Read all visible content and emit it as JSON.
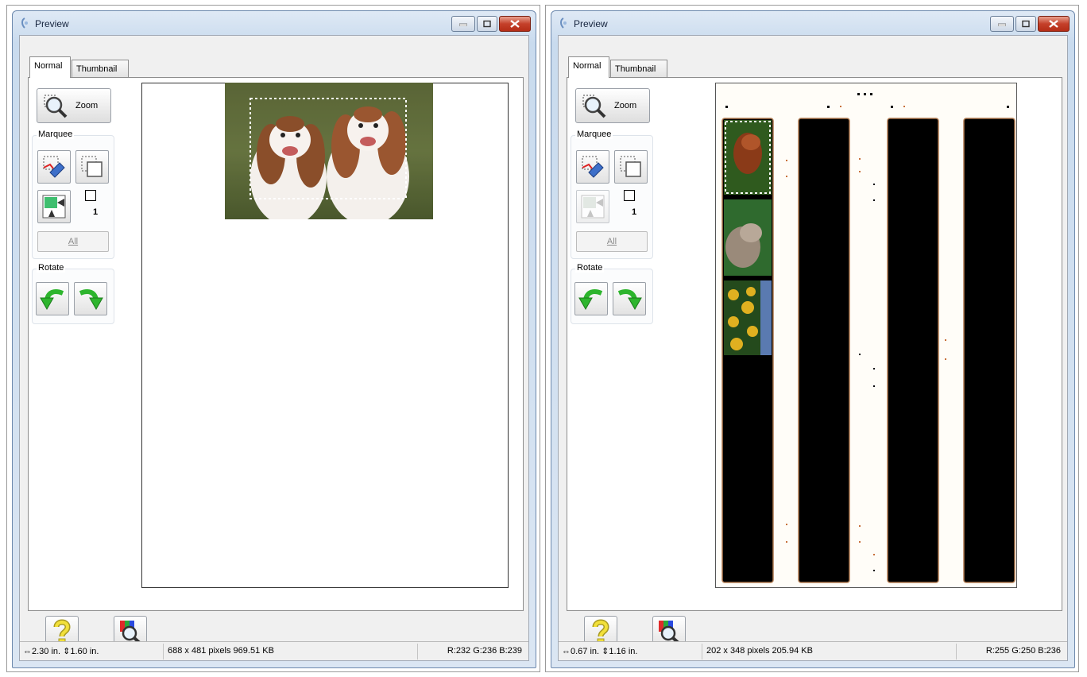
{
  "windows": [
    {
      "title": "Preview",
      "tabs": [
        {
          "label": "Normal",
          "active": true
        },
        {
          "label": "Thumbnail",
          "active": false
        }
      ],
      "zoom_label": "Zoom",
      "marquee_label": "Marquee",
      "marquee_count": "1",
      "all_label": "All",
      "rotate_label": "Rotate",
      "status": {
        "size": "⇔2.30 in. ⇕1.60 in.",
        "pixels": "688 x 481 pixels 969.51 KB",
        "rgb": "R:232 G:236 B:239"
      }
    },
    {
      "title": "Preview",
      "tabs": [
        {
          "label": "Normal",
          "active": true
        },
        {
          "label": "Thumbnail",
          "active": false
        }
      ],
      "zoom_label": "Zoom",
      "marquee_label": "Marquee",
      "marquee_count": "1",
      "all_label": "All",
      "rotate_label": "Rotate",
      "status": {
        "size": "⇔0.67 in. ⇕1.16 in.",
        "pixels": "202 x 348 pixels 205.94 KB",
        "rgb": "R:255 G:250 B:236"
      }
    }
  ],
  "icons": {
    "title": "scanner-icon",
    "zoom": "magnifier-icon",
    "marquee_create": "create-marquee-icon",
    "marquee_duplicate": "duplicate-marquee-icon",
    "auto_locate": "auto-locate-icon",
    "rotate_left": "rotate-left-icon",
    "rotate_right": "rotate-right-icon",
    "help": "help-icon",
    "densitometer": "densitometer-icon"
  },
  "colors": {
    "title_bar": "#c9dbee",
    "close_button": "#c4402a",
    "rotate_arrow": "#2db52d",
    "film_strip": "#000000"
  }
}
